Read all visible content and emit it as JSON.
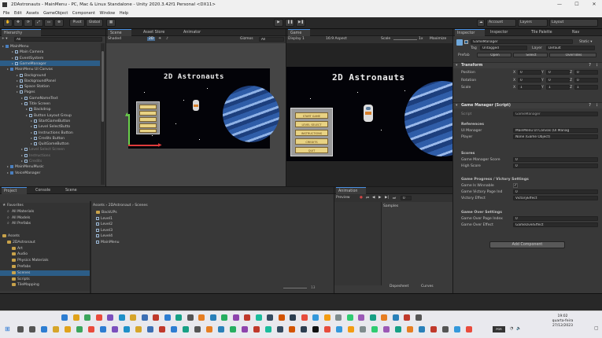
{
  "window": {
    "title": "2DAstronauts - MainMenu - PC, Mac & Linux Standalone - Unity 2020.3.42f1 Personal <DX11>",
    "minimize": "—",
    "maximize": "☐",
    "close": "✕"
  },
  "menu": [
    "File",
    "Edit",
    "Assets",
    "GameObject",
    "Component",
    "Window",
    "Help"
  ],
  "toolbar": {
    "pivot": "Pivot",
    "global": "Global",
    "play": "▶",
    "pause": "❚❚",
    "step": "▶❚",
    "account": "Account",
    "layers": "Layers",
    "layout": "Layout"
  },
  "hierarchy": {
    "tab": "Hierarchy",
    "create": "+ ▾",
    "search_placeholder": "All",
    "rows": [
      {
        "label": "MainMenu",
        "depth": 0,
        "icon": "unity",
        "selected": false
      },
      {
        "label": "Main Camera",
        "depth": 2,
        "icon": "cube",
        "selected": false
      },
      {
        "label": "EventSystem",
        "depth": 2,
        "icon": "cube",
        "selected": false
      },
      {
        "label": "GameManager",
        "depth": 2,
        "icon": "cube",
        "selected": true
      },
      {
        "label": "MainMenu UI Canvas",
        "depth": 1,
        "icon": "cubeb",
        "selected": false
      },
      {
        "label": "Background",
        "depth": 3,
        "icon": "cube",
        "selected": false
      },
      {
        "label": "BackgroundPanel",
        "depth": 3,
        "icon": "cube",
        "selected": false
      },
      {
        "label": "Space Station",
        "depth": 3,
        "icon": "cube",
        "selected": false
      },
      {
        "label": "Pages",
        "depth": 3,
        "icon": "cube",
        "selected": false
      },
      {
        "label": "GameNameText",
        "depth": 4,
        "icon": "cube",
        "selected": false
      },
      {
        "label": "Title Screen",
        "depth": 4,
        "icon": "cube",
        "selected": false
      },
      {
        "label": "Backdrop",
        "depth": 5,
        "icon": "cube",
        "selected": false
      },
      {
        "label": "Button Layout Group",
        "depth": 5,
        "icon": "cube",
        "selected": false
      },
      {
        "label": "StartGameButton",
        "depth": 6,
        "icon": "cube",
        "selected": false
      },
      {
        "label": "Level SelectButto",
        "depth": 6,
        "icon": "cube",
        "selected": false
      },
      {
        "label": "Instructions Button",
        "depth": 6,
        "icon": "cube",
        "selected": false
      },
      {
        "label": "Credits Button",
        "depth": 6,
        "icon": "cube",
        "selected": false
      },
      {
        "label": "QuitGameButton",
        "depth": 6,
        "icon": "cube",
        "selected": false
      },
      {
        "label": "Level Select Screen",
        "depth": 4,
        "icon": "cube",
        "selected": false,
        "dim": true
      },
      {
        "label": "Instructions",
        "depth": 4,
        "icon": "cube",
        "selected": false,
        "dim": true
      },
      {
        "label": "Credits",
        "depth": 4,
        "icon": "cube",
        "selected": false,
        "dim": true
      },
      {
        "label": "MainMenuMusic",
        "depth": 1,
        "icon": "cubeb",
        "selected": false
      },
      {
        "label": "VoiceManager",
        "depth": 1,
        "icon": "cubeb",
        "selected": false
      }
    ]
  },
  "scene": {
    "tabs": [
      "Scene",
      "Asset Store",
      "Animator"
    ],
    "shading": "Shaded",
    "twod": "2D",
    "gizmos": "Gizmos",
    "search": "All"
  },
  "game": {
    "tab": "Game",
    "display": "Display 1",
    "aspect": "16:9 Aspect",
    "scale_label": "Scale",
    "scale_value": "1x",
    "maximize": "Maximize",
    "title": "2D Astronauts",
    "buttons": [
      "START GAME",
      "LEVEL SELECT",
      "INSTRUCTIONS",
      "CREDITS",
      "QUIT"
    ]
  },
  "project": {
    "tabs": [
      "Project",
      "Console",
      "Scene"
    ],
    "tree": [
      {
        "label": "Favorites",
        "depth": 0,
        "icon": "star"
      },
      {
        "label": "All Materials",
        "depth": 1,
        "icon": "search"
      },
      {
        "label": "All Models",
        "depth": 1,
        "icon": "search"
      },
      {
        "label": "All Prefabs",
        "depth": 1,
        "icon": "search"
      },
      {
        "label": "",
        "depth": 0,
        "icon": "none"
      },
      {
        "label": "Assets",
        "depth": 0,
        "icon": "folder"
      },
      {
        "label": "2DAstronaut",
        "depth": 1,
        "icon": "folder"
      },
      {
        "label": "Art",
        "depth": 2,
        "icon": "folder"
      },
      {
        "label": "Audio",
        "depth": 2,
        "icon": "folder"
      },
      {
        "label": "Physics Materials",
        "depth": 2,
        "icon": "folder"
      },
      {
        "label": "Prefabs",
        "depth": 2,
        "icon": "folder"
      },
      {
        "label": "Scenes",
        "depth": 2,
        "icon": "folder",
        "selected": true
      },
      {
        "label": "Scripts",
        "depth": 2,
        "icon": "folder"
      },
      {
        "label": "TileMapping",
        "depth": 2,
        "icon": "folder"
      }
    ],
    "breadcrumb": [
      "Assets",
      "2DAstronaut",
      "Scenes"
    ],
    "files": [
      {
        "label": "BackUPs",
        "icon": "folder"
      },
      {
        "label": "Level1",
        "icon": "unity"
      },
      {
        "label": "Level2",
        "icon": "unity"
      },
      {
        "label": "Level3",
        "icon": "unity"
      },
      {
        "label": "Level4",
        "icon": "unity"
      },
      {
        "label": "MainMenu",
        "icon": "unity"
      }
    ],
    "count": "13"
  },
  "animation": {
    "tab": "Animation",
    "preview": "Preview",
    "frame": "0",
    "samples": "Samples",
    "dopesheet": "Dopesheet",
    "curves": "Curves"
  },
  "inspector": {
    "tabs": [
      "Inspector",
      "Inspector",
      "Tile Palette",
      "Nav"
    ],
    "object_name": "GameManager",
    "static": "Static ▾",
    "tag_label": "Tag",
    "tag_value": "Untagged",
    "layer_label": "Layer",
    "layer_value": "Default",
    "prefab_label": "Prefab",
    "prefab_open": "Open",
    "prefab_select": "Select",
    "prefab_overrides": "Overrides",
    "transform": {
      "header": "Transform",
      "rows": [
        {
          "label": "Position",
          "x": "0",
          "y": "0",
          "z": "0"
        },
        {
          "label": "Rotation",
          "x": "0",
          "y": "0",
          "z": "0"
        },
        {
          "label": "Scale",
          "x": "1",
          "y": "1",
          "z": "1"
        }
      ]
    },
    "script": {
      "header": "Game Manager (Script)",
      "script_label": "Script",
      "script_value": "GameManager",
      "refs_header": "References",
      "ui_manager_label": "UI Manager",
      "ui_manager_value": "MainMenu UI Canvas (UI Manag",
      "player_label": "Player",
      "player_value": "None (Game Object)",
      "scores_header": "Scores",
      "score_label": "Game Manager Score",
      "score_value": "0",
      "high_label": "High Score",
      "high_value": "0",
      "progress_header": "Game Progress / Victory Settings",
      "winnable_label": "Game Is Winnable",
      "winnable_value": "✓",
      "victory_page_label": "Game Victory Page Ind",
      "victory_page_value": "0",
      "victory_effect_label": "Victory Effect",
      "victory_effect_value": "VictoryEffect",
      "over_header": "Game Over Settings",
      "over_page_label": "Game Over Page Index",
      "over_page_value": "0",
      "over_effect_label": "Game Over Effect",
      "over_effect_value": "GameOverEffect"
    },
    "add_component": "Add Component"
  },
  "taskbar": {
    "time": "19:02",
    "day": "quarta-feira",
    "date": "27/12/2023",
    "lang": "POR"
  }
}
